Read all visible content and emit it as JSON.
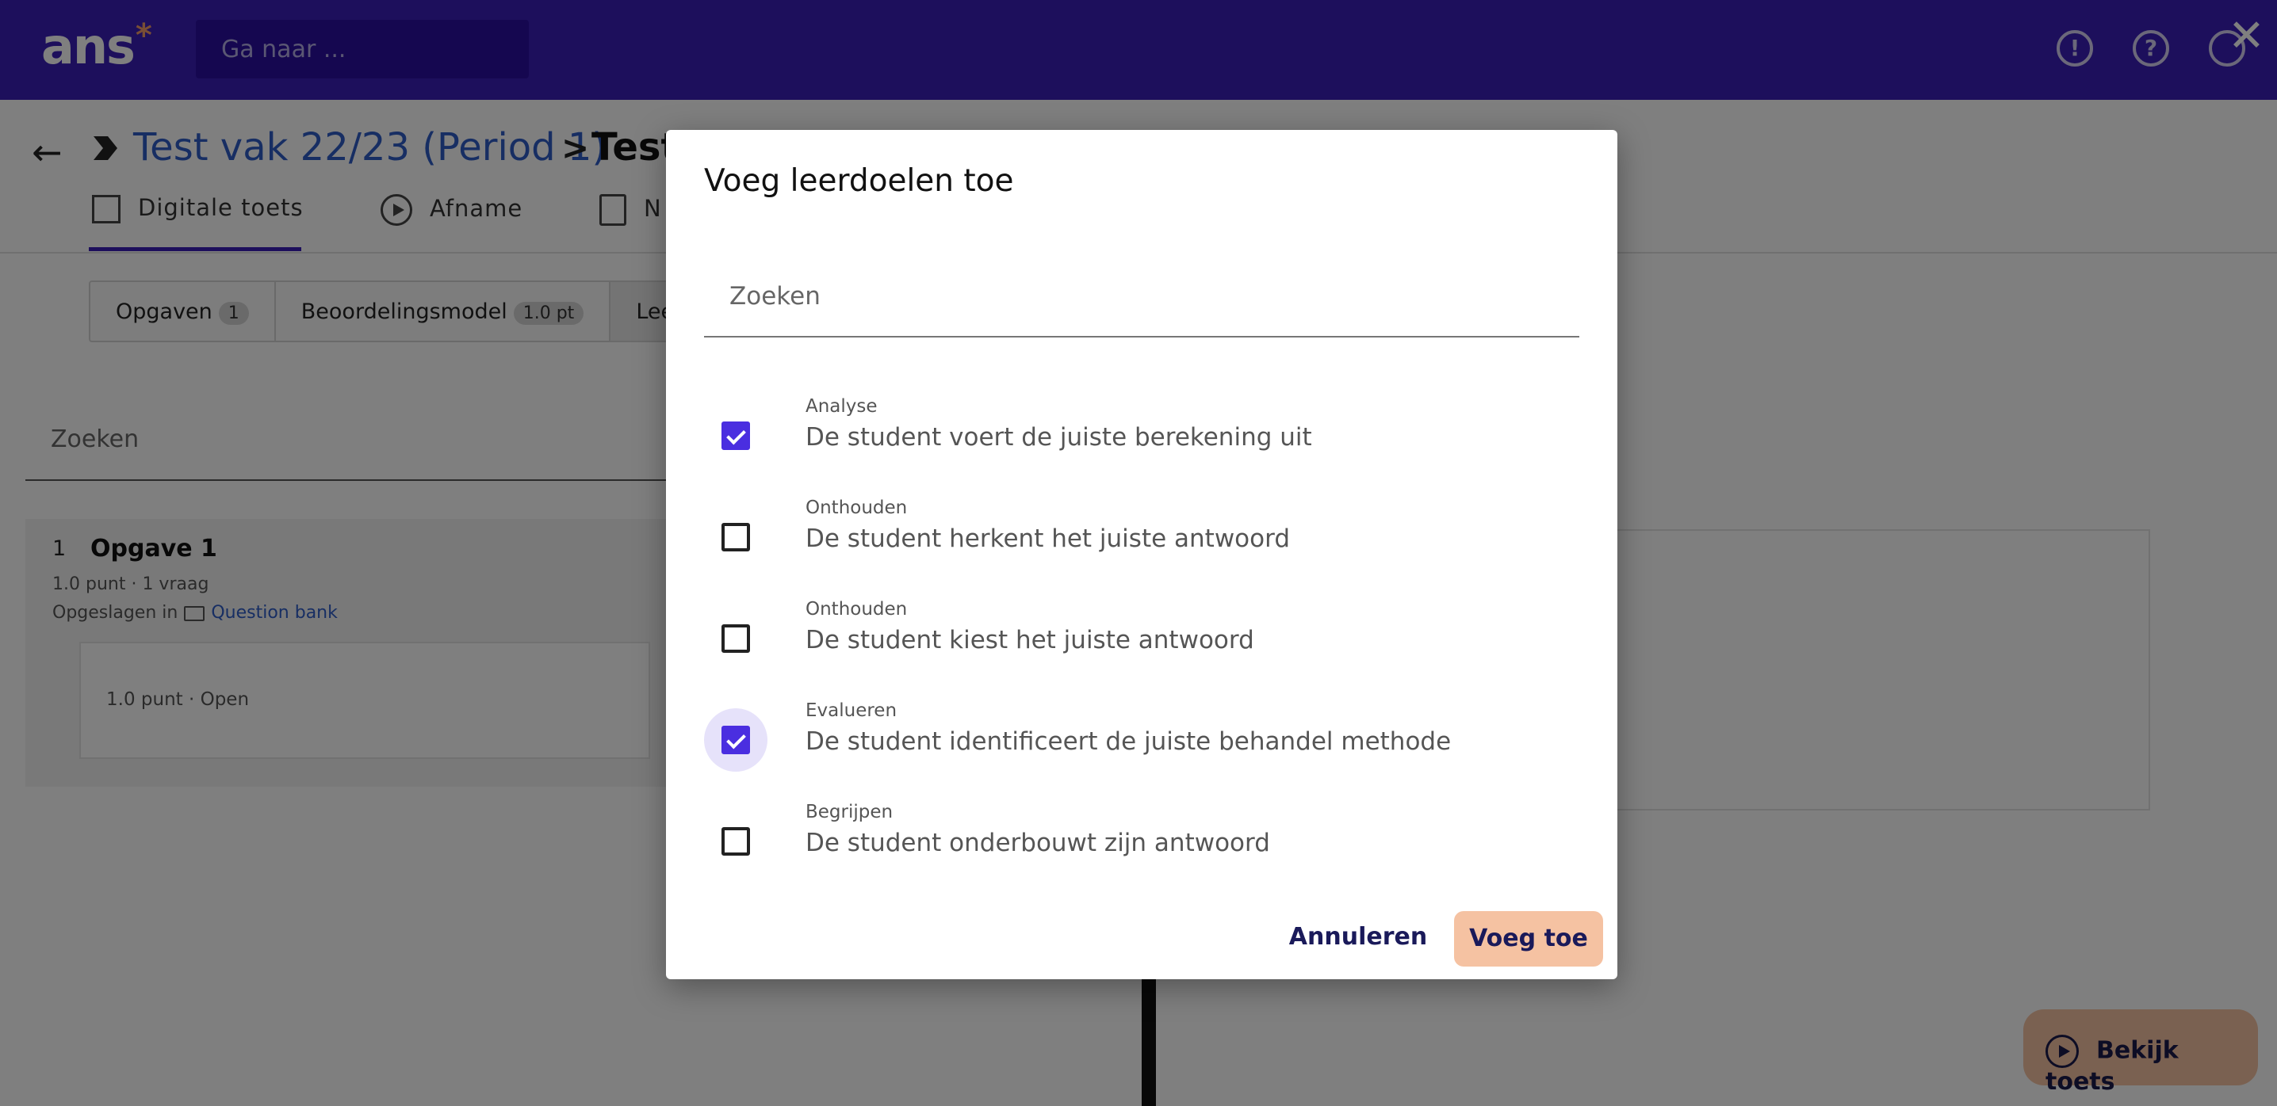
{
  "app": {
    "logo": "ans",
    "logo_star": "*",
    "goto_placeholder": "Ga naar ..."
  },
  "header_icons": {
    "notifications": "bell-icon",
    "help": "help-icon",
    "profile": "profile-icon",
    "close": "✕"
  },
  "breadcrumb": {
    "course": "Test vak 22/23 (Period 1)",
    "separator": ">",
    "current": "Test"
  },
  "tabs": [
    {
      "label": "Digitale toets",
      "icon": "grid-icon"
    },
    {
      "label": "Afname",
      "icon": "play-icon"
    },
    {
      "label": "N",
      "icon": "clipboard-search-icon"
    }
  ],
  "segments": [
    {
      "label": "Opgaven",
      "badge": "1"
    },
    {
      "label": "Beoordelingsmodel",
      "badge": "1.0 pt"
    },
    {
      "label": "Leer",
      "badge": ""
    }
  ],
  "page_search": {
    "placeholder": "Zoeken"
  },
  "question": {
    "number": "1",
    "title": "Opgave 1",
    "meta": "1.0 punt · 1 vraag",
    "saved_prefix": "Opgeslagen in",
    "saved_link": "Question bank",
    "item": "1.0 punt · Open"
  },
  "preview_button": "Bekijk toets",
  "modal": {
    "title": "Voeg leerdoelen toe",
    "search_placeholder": "Zoeken",
    "options": [
      {
        "category": "Analyse",
        "text": "De student voert de juiste berekening uit",
        "checked": true
      },
      {
        "category": "Onthouden",
        "text": "De student herkent het juiste antwoord",
        "checked": false
      },
      {
        "category": "Onthouden",
        "text": "De student kiest het juiste antwoord",
        "checked": false
      },
      {
        "category": "Evalueren",
        "text": "De student identificeert de juiste behandel methode",
        "checked": true
      },
      {
        "category": "Begrijpen",
        "text": "De student onderbouwt zijn antwoord",
        "checked": false
      }
    ],
    "cancel_label": "Annuleren",
    "add_label": "Voeg toe"
  },
  "colors": {
    "primary": "#3a1fb8",
    "accent": "#f5c2a2",
    "checkbox": "#4a2ee0",
    "link": "#2f5dc7"
  }
}
